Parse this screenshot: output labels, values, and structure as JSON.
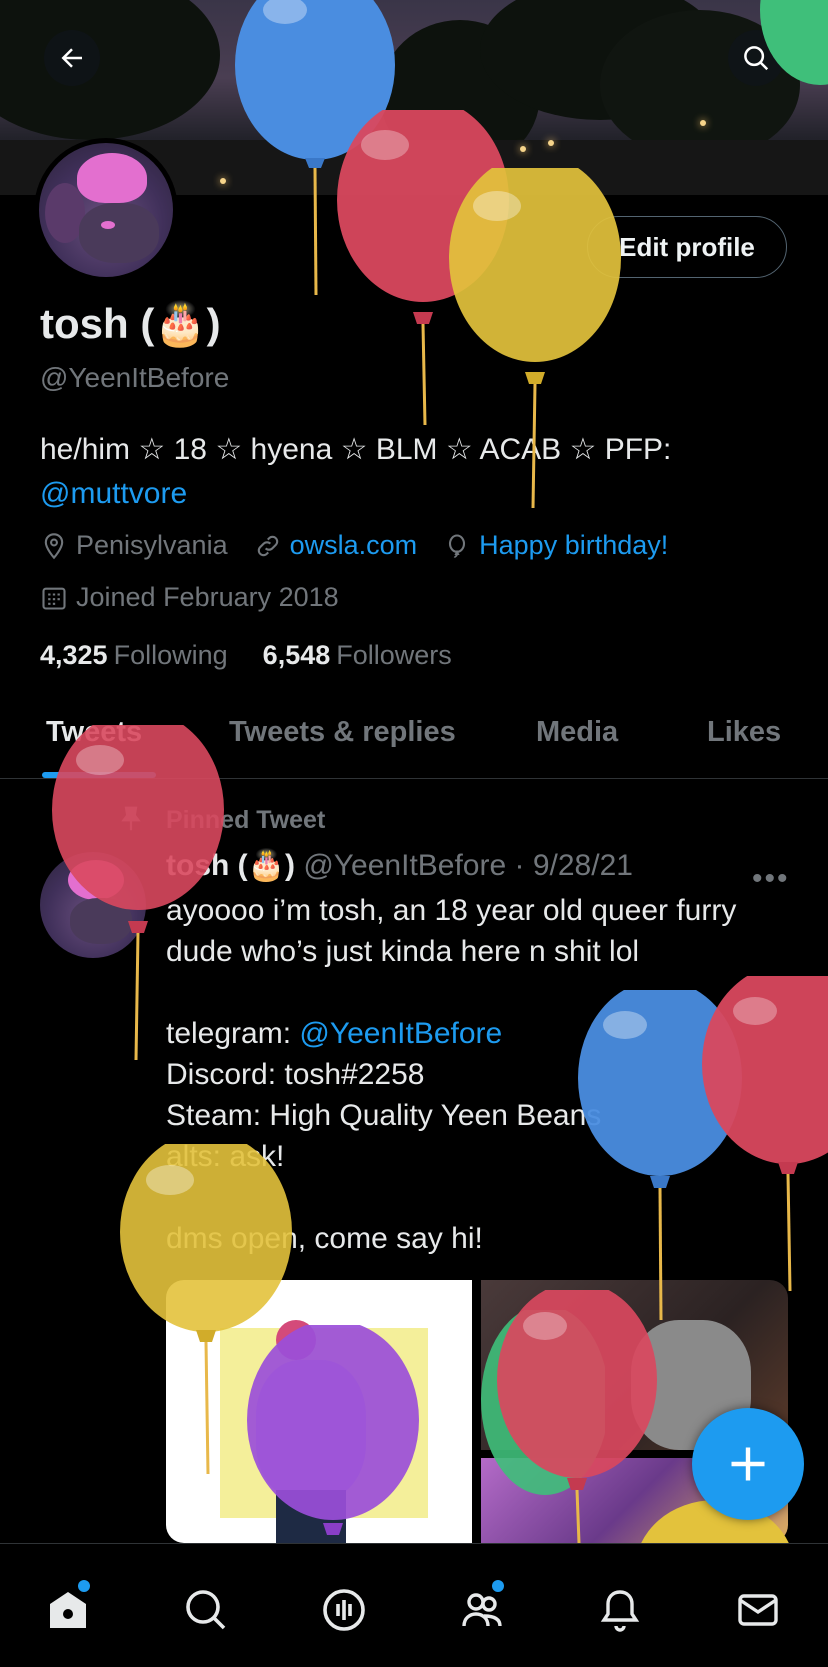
{
  "header": {
    "back_icon": "arrow-left-icon",
    "search_icon": "search-icon"
  },
  "profile": {
    "name": "tosh (🎂)",
    "handle": "@YeenItBefore",
    "edit_button": "Edit profile",
    "bio_text": "he/him ☆ 18 ☆ hyena ☆ BLM ☆ ACAB ☆ PFP:",
    "bio_link": "@muttvore",
    "location": "Penisylvania",
    "website": "owsla.com",
    "birthday": "Happy birthday!",
    "joined": "Joined February 2018",
    "following_count": "4,325",
    "following_label": "Following",
    "followers_count": "6,548",
    "followers_label": "Followers"
  },
  "tabs": [
    "Tweets",
    "Tweets & replies",
    "Media",
    "Likes"
  ],
  "pinned_tweet": {
    "pinned_label": "Pinned Tweet",
    "author_name": "tosh (🎂)",
    "author_handle": "@YeenItBefore",
    "date": "· 9/28/21",
    "more": "•••",
    "text_line1": "ayoooo i’m tosh, an 18 year old queer furry dude who’s just kinda here n shit lol",
    "telegram_label": "telegram: ",
    "telegram_link": "@YeenItBefore",
    "text_rest": "Discord: tosh#2258\nSteam: High Quality Yeen Beans\nalts: ask!\n\ndms open, come say hi!"
  },
  "fab": {
    "icon": "plus-icon"
  },
  "bottom_nav": [
    "home-icon",
    "search-icon",
    "spaces-icon",
    "communities-icon",
    "notifications-icon",
    "messages-icon"
  ],
  "colors": {
    "accent": "#1d9bf0",
    "background": "#000000",
    "muted": "#71767b"
  }
}
